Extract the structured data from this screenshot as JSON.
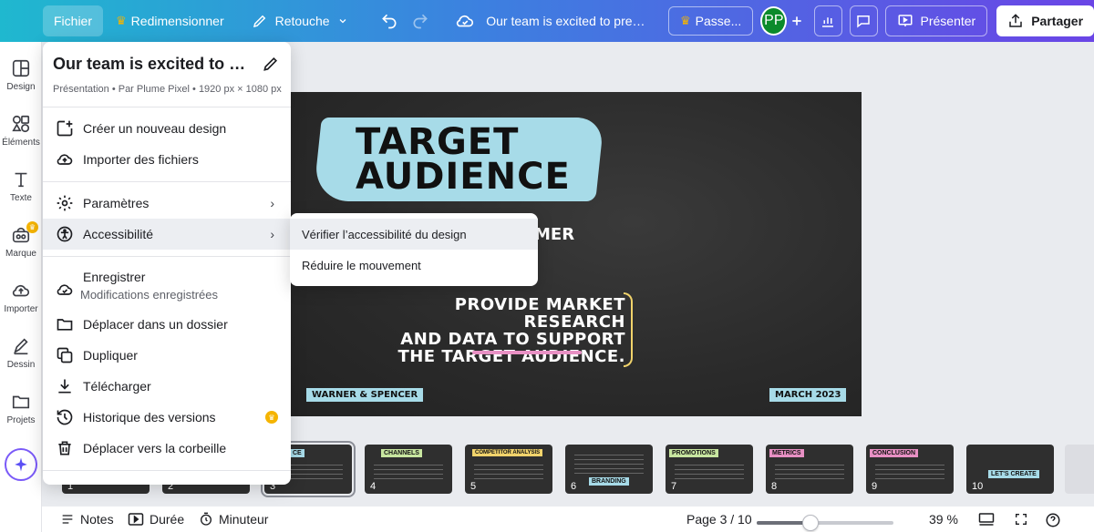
{
  "topbar": {
    "file_label": "Fichier",
    "resize_label": "Redimensionner",
    "retouch_label": "Retouche",
    "doc_title": "Our team is excited to present ...",
    "upgrade_label": "Passe...",
    "avatar_initials": "PP",
    "present_label": "Présenter",
    "share_label": "Partager",
    "accent_gradient": [
      "#1fb8cf",
      "#3d7fe0",
      "#6a45e6"
    ]
  },
  "sidebar": {
    "items": [
      {
        "label": "Design",
        "icon": "layout-icon"
      },
      {
        "label": "Éléments",
        "icon": "shapes-icon"
      },
      {
        "label": "Texte",
        "icon": "text-icon"
      },
      {
        "label": "Marque",
        "icon": "brand-icon"
      },
      {
        "label": "Importer",
        "icon": "upload-icon"
      },
      {
        "label": "Dessin",
        "icon": "pen-icon"
      },
      {
        "label": "Projets",
        "icon": "folder-icon"
      }
    ]
  },
  "file_menu": {
    "title": "Our team is excited to present ...",
    "subtitle": "Présentation • Par Plume Pixel • 1920 px × 1080 px",
    "items": [
      {
        "label": "Créer un nouveau design",
        "icon": "plus-square-icon"
      },
      {
        "label": "Importer des fichiers",
        "icon": "cloud-upload-icon"
      },
      {
        "label": "Paramètres",
        "icon": "gear-icon"
      },
      {
        "label": "Accessibilité",
        "icon": "accessibility-icon"
      },
      {
        "label": "Enregistrer",
        "icon": "cloud-check-icon",
        "sub": "Modifications enregistrées"
      },
      {
        "label": "Déplacer dans un dossier",
        "icon": "folder-icon"
      },
      {
        "label": "Dupliquer",
        "icon": "duplicate-icon"
      },
      {
        "label": "Télécharger",
        "icon": "download-icon"
      },
      {
        "label": "Historique des versions",
        "icon": "history-icon"
      },
      {
        "label": "Déplacer vers la corbeille",
        "icon": "trash-icon"
      }
    ]
  },
  "submenu": {
    "items": [
      {
        "label": "Vérifier l’accessibilité du design"
      },
      {
        "label": "Réduire le mouvement"
      }
    ]
  },
  "slide": {
    "title_line1": "TARGET",
    "title_line2": "AUDIENCE",
    "partial_text": "MER",
    "body_line1": "PROVIDE MARKET RESEARCH",
    "body_line2": "AND DATA TO SUPPORT",
    "body_line3": "THE TARGET AUDIENCE.",
    "footer_left": "WARNER & SPENCER",
    "footer_right": "MARCH 2023"
  },
  "thumbnails": [
    {
      "num": "1",
      "label": ""
    },
    {
      "num": "2",
      "label": ""
    },
    {
      "num": "3",
      "label": "CE"
    },
    {
      "num": "4",
      "label": "CHANNELS"
    },
    {
      "num": "5",
      "label": "COMPETITOR ANALYSIS"
    },
    {
      "num": "6",
      "label": "BRANDING"
    },
    {
      "num": "7",
      "label": "PROMOTIONS"
    },
    {
      "num": "8",
      "label": "METRICS"
    },
    {
      "num": "9",
      "label": "CONCLUSION"
    },
    {
      "num": "10",
      "label": "LET'S CREATE"
    }
  ],
  "bottombar": {
    "notes_label": "Notes",
    "duration_label": "Durée",
    "timer_label": "Minuteur",
    "page_label": "Page 3 / 10",
    "zoom_label": "39 %",
    "zoom_fraction": 0.39
  }
}
